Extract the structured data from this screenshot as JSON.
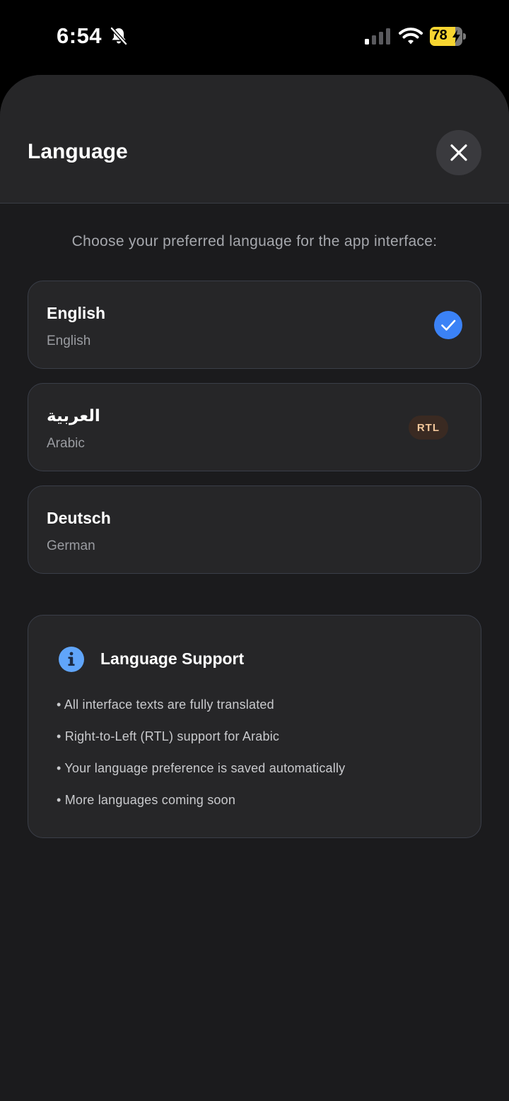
{
  "status_bar": {
    "time": "6:54",
    "battery_level": "78",
    "battery_fraction": 0.78,
    "icons": [
      "bell-slash-icon",
      "cellular-signal-icon",
      "wifi-icon",
      "battery-charging-icon"
    ]
  },
  "sheet": {
    "title": "Language",
    "close_icon": "close-icon"
  },
  "subtitle": "Choose your preferred language for the app interface:",
  "languages": [
    {
      "native": "English",
      "english": "English",
      "selected": true,
      "badge": ""
    },
    {
      "native": "العربية",
      "english": "Arabic",
      "selected": false,
      "badge": "RTL"
    },
    {
      "native": "Deutsch",
      "english": "German",
      "selected": false,
      "badge": ""
    }
  ],
  "info": {
    "title": "Language Support",
    "icon": "info-icon",
    "items": [
      "• All interface texts are fully translated",
      "• Right-to-Left (RTL) support for Arabic",
      "• Your language preference is saved automatically",
      "• More languages coming soon"
    ]
  },
  "colors": {
    "accent": "#3b82f6",
    "sheet_background": "#1b1b1d",
    "card_background": "#262628",
    "badge_text": "#f3c79b",
    "battery": "#f7d531"
  }
}
